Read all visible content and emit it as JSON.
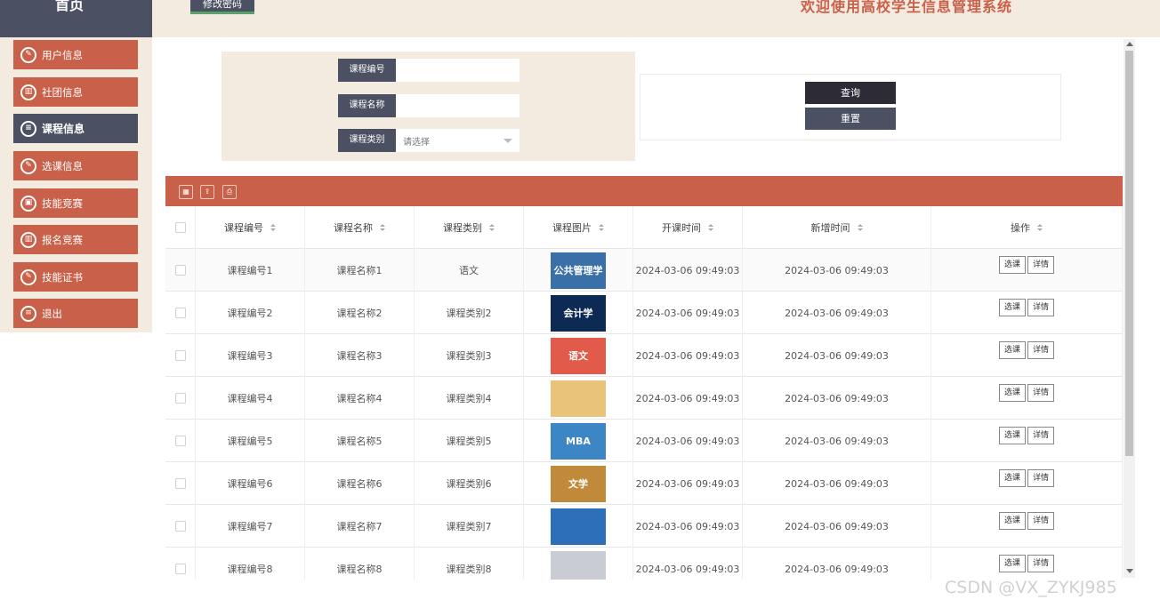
{
  "header": {
    "home_label": "首页",
    "change_password": "修改密码",
    "welcome": "欢迎使用高校学生信息管理系统"
  },
  "sidebar": {
    "items": [
      {
        "label": "用户信息",
        "icon": "edit-icon",
        "active": false
      },
      {
        "label": "社团信息",
        "icon": "bar-chart-icon",
        "active": false
      },
      {
        "label": "课程信息",
        "icon": "list-icon",
        "active": true
      },
      {
        "label": "选课信息",
        "icon": "edit-icon",
        "active": false
      },
      {
        "label": "技能竞赛",
        "icon": "user-card-icon",
        "active": false
      },
      {
        "label": "报名竞赛",
        "icon": "bar-chart-icon",
        "active": false
      },
      {
        "label": "技能证书",
        "icon": "edit-icon",
        "active": false
      },
      {
        "label": "退出",
        "icon": "list-icon",
        "active": false
      }
    ]
  },
  "search": {
    "course_id_label": "课程编号",
    "course_id_value": "",
    "course_name_label": "课程名称",
    "course_name_value": "",
    "course_type_label": "课程类别",
    "course_type_placeholder": "请选择",
    "query_button": "查询",
    "reset_button": "重置"
  },
  "toolbar": {
    "icons": [
      "table-icon",
      "upload-icon",
      "print-icon"
    ]
  },
  "table": {
    "columns": [
      "课程编号",
      "课程名称",
      "课程类别",
      "课程图片",
      "开课时间",
      "新增时间",
      "操作"
    ],
    "rows": [
      {
        "id": "课程编号1",
        "name": "课程名称1",
        "type": "语文",
        "image_text": "公共管理学",
        "image_color": "#3a6fa8",
        "start": "2024-03-06 09:49:03",
        "added": "2024-03-06 09:49:03"
      },
      {
        "id": "课程编号2",
        "name": "课程名称2",
        "type": "课程类别2",
        "image_text": "会计学",
        "image_color": "#0d2a55",
        "start": "2024-03-06 09:49:03",
        "added": "2024-03-06 09:49:03"
      },
      {
        "id": "课程编号3",
        "name": "课程名称3",
        "type": "课程类别3",
        "image_text": "语文",
        "image_color": "#e25b4a",
        "start": "2024-03-06 09:49:03",
        "added": "2024-03-06 09:49:03"
      },
      {
        "id": "课程编号4",
        "name": "课程名称4",
        "type": "课程类别4",
        "image_text": "",
        "image_color": "#e9c37a",
        "start": "2024-03-06 09:49:03",
        "added": "2024-03-06 09:49:03"
      },
      {
        "id": "课程编号5",
        "name": "课程名称5",
        "type": "课程类别5",
        "image_text": "MBA",
        "image_color": "#3d86c6",
        "start": "2024-03-06 09:49:03",
        "added": "2024-03-06 09:49:03"
      },
      {
        "id": "课程编号6",
        "name": "课程名称6",
        "type": "课程类别6",
        "image_text": "文学",
        "image_color": "#c08a3a",
        "start": "2024-03-06 09:49:03",
        "added": "2024-03-06 09:49:03"
      },
      {
        "id": "课程编号7",
        "name": "课程名称7",
        "type": "课程类别7",
        "image_text": "",
        "image_color": "#2e6fb9",
        "start": "2024-03-06 09:49:03",
        "added": "2024-03-06 09:49:03"
      },
      {
        "id": "课程编号8",
        "name": "课程名称8",
        "type": "课程类别8",
        "image_text": "",
        "image_color": "#c9ccd2",
        "start": "2024-03-06 09:49:03",
        "added": "2024-03-06 09:49:03"
      }
    ],
    "select_button": "选课",
    "detail_button": "详情"
  },
  "watermark": "CSDN @VX_ZYKJ985",
  "colors": {
    "accent": "#c9604a",
    "dark": "#4b5163",
    "panel": "#f3ebe0"
  }
}
